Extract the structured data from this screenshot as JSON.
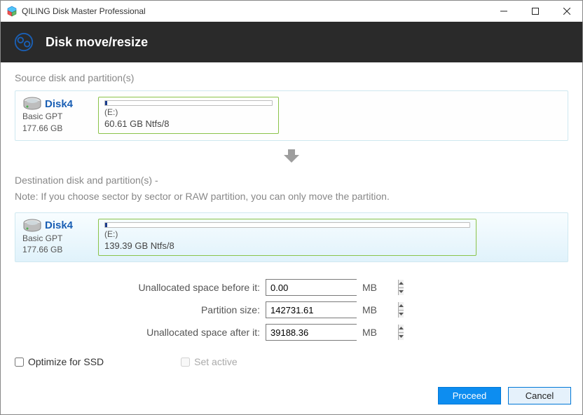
{
  "app": {
    "title": "QILING Disk Master Professional"
  },
  "header": {
    "title": "Disk move/resize"
  },
  "sections": {
    "source_label": "Source disk and partition(s)",
    "dest_label": "Destination disk and partition(s) -",
    "note": "Note: If you choose sector by sector or RAW partition, you can only move the partition."
  },
  "source_disk": {
    "name": "Disk4",
    "type": "Basic GPT",
    "size": "177.66 GB",
    "partition": {
      "drive": "(E:)",
      "info": "60.61 GB Ntfs/8"
    }
  },
  "dest_disk": {
    "name": "Disk4",
    "type": "Basic GPT",
    "size": "177.66 GB",
    "partition": {
      "drive": "(E:)",
      "info": "139.39 GB Ntfs/8"
    }
  },
  "fields": {
    "before_label": "Unallocated space before it:",
    "before_value": "0.00",
    "size_label": "Partition size:",
    "size_value": "142731.61",
    "after_label": "Unallocated space after it:",
    "after_value": "39188.36",
    "unit": "MB"
  },
  "options": {
    "ssd_label": "Optimize for SSD",
    "active_label": "Set active"
  },
  "buttons": {
    "proceed": "Proceed",
    "cancel": "Cancel"
  }
}
